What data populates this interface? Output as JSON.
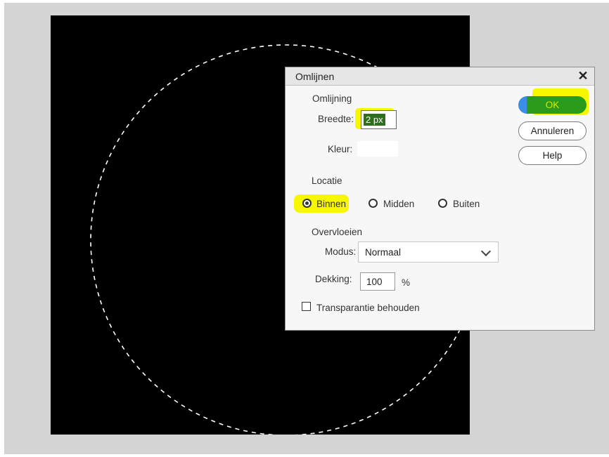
{
  "dialog": {
    "title": "Omlijnen",
    "close_glyph": "✕",
    "sections": {
      "stroke": "Omlijning",
      "location": "Locatie",
      "blending": "Overvloeien"
    },
    "width": {
      "label": "Breedte:",
      "value": "2 px"
    },
    "color": {
      "label": "Kleur:",
      "value": "#ffffff"
    },
    "location_options": [
      {
        "label": "Binnen",
        "checked": true
      },
      {
        "label": "Midden",
        "checked": false
      },
      {
        "label": "Buiten",
        "checked": false
      }
    ],
    "mode": {
      "label": "Modus:",
      "value": "Normaal"
    },
    "opacity": {
      "label": "Dekking:",
      "value": "100",
      "unit": "%"
    },
    "preserve_transparency": {
      "label": "Transparantie behouden",
      "checked": false
    },
    "buttons": {
      "ok": "OK",
      "cancel": "Annuleren",
      "help": "Help"
    }
  },
  "colors": {
    "highlight": "#f7f700",
    "ok_button": "#2a9b1a",
    "canvas": "#000000",
    "workspace": "#d4d4d4"
  },
  "icons": [
    "close-icon",
    "chevron-down-icon",
    "radio-icon",
    "checkbox-icon"
  ]
}
